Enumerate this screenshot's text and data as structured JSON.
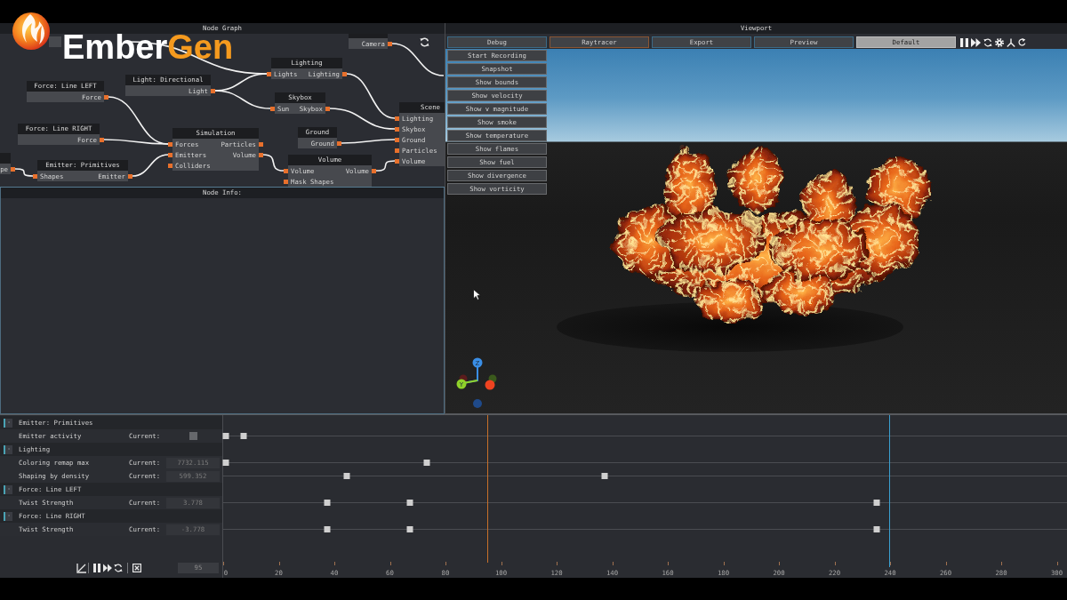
{
  "logo": {
    "primary": "Ember",
    "accent": "Gen"
  },
  "node_graph": {
    "title": "Node Graph",
    "nodes": [
      {
        "outputs": [
          "Camera"
        ]
      },
      {
        "title": "Lighting",
        "inputs": [
          "Lights"
        ],
        "outputs": [
          "Lighting"
        ]
      },
      {
        "title": "Light: Directional",
        "outputs": [
          "Light"
        ]
      },
      {
        "title": "Force: Line LEFT",
        "outputs": [
          "Force"
        ]
      },
      {
        "title": "Skybox",
        "inputs": [
          "Sun"
        ],
        "outputs": [
          "Skybox"
        ]
      },
      {
        "title": "Force: Line RIGHT",
        "outputs": [
          "Force"
        ]
      },
      {
        "title": "Simulation",
        "inputs": [
          "Forces",
          "Emitters",
          "Colliders"
        ],
        "outputs": [
          "Particles",
          "Volume"
        ]
      },
      {
        "title": "Ground",
        "outputs": [
          "Ground"
        ]
      },
      {
        "title": "Scene",
        "inputs": [
          "Lighting",
          "Skybox",
          "Ground",
          "Particles",
          "Volume"
        ]
      },
      {
        "outputs": [
          "pe"
        ]
      },
      {
        "title": "Emitter: Primitives",
        "inputs": [
          "Shapes"
        ],
        "outputs": [
          "Emitter"
        ]
      },
      {
        "title": "Volume",
        "inputs": [
          "Volume",
          "Mask Shapes"
        ],
        "outputs": [
          "Volume"
        ]
      }
    ]
  },
  "node_info": {
    "title": "Node Info:"
  },
  "viewport": {
    "title": "Viewport",
    "tabs": [
      {
        "label": "Debug",
        "selected": false,
        "highlighted": false
      },
      {
        "label": "Raytracer",
        "selected": false,
        "highlighted": true
      },
      {
        "label": "Export",
        "selected": false,
        "highlighted": false
      },
      {
        "label": "Preview",
        "selected": false,
        "highlighted": false
      },
      {
        "label": "Default",
        "selected": true,
        "highlighted": false
      }
    ],
    "debug_buttons": [
      "Start Recording",
      "Snapshot",
      "Show bounds",
      "Show velocity",
      "Show v magnitude",
      "Show smoke",
      "Show temperature",
      "Show flames",
      "Show fuel",
      "Show divergence",
      "Show vorticity"
    ],
    "axis_labels": [
      "Z",
      "Y"
    ]
  },
  "timeline": {
    "groups": [
      {
        "title": "Emitter: Primitives",
        "toggle": "-",
        "expanded": true,
        "properties": [
          {
            "name": "Emitter activity",
            "label": "Current:",
            "kind": "checkbox",
            "checked": false,
            "keyframes": [
              {
                "level": 0.003
              },
              {
                "level": 0.024
              }
            ]
          }
        ]
      },
      {
        "title": "Lighting",
        "toggle": "-",
        "expanded": true,
        "properties": [
          {
            "name": "Coloring remap max",
            "label": "Current:",
            "kind": "number",
            "value": "7732.115",
            "keyframes": [
              {
                "level": 0.003
              },
              {
                "level": 0.241
              }
            ]
          },
          {
            "name": "Shaping by density",
            "label": "Current:",
            "kind": "number",
            "value": "599.352",
            "keyframes": [
              {
                "level": 0.146
              },
              {
                "level": 0.452
              }
            ]
          }
        ]
      },
      {
        "title": "Force: Line LEFT",
        "toggle": "-",
        "expanded": true,
        "properties": [
          {
            "name": "Twist Strength",
            "label": "Current:",
            "kind": "number",
            "value": "3.778",
            "keyframes": [
              {
                "level": 0.123
              },
              {
                "level": 0.221
              },
              {
                "level": 0.774
              }
            ]
          }
        ]
      },
      {
        "title": "Force: Line RIGHT",
        "toggle": "-",
        "expanded": true,
        "properties": [
          {
            "name": "Twist Strength",
            "label": "Current:",
            "kind": "number",
            "value": "-3.778",
            "keyframes": [
              {
                "level": 0.123
              },
              {
                "level": 0.221
              },
              {
                "level": 0.774
              }
            ]
          }
        ]
      }
    ],
    "current_frame": "95",
    "playhead": {
      "level": 0.313
    },
    "end_marker": {
      "level": 0.789
    },
    "ticks": [
      "0",
      "20",
      "40",
      "60",
      "80",
      "100",
      "120",
      "140",
      "160",
      "180",
      "200",
      "220",
      "240",
      "260",
      "280",
      "300"
    ]
  }
}
